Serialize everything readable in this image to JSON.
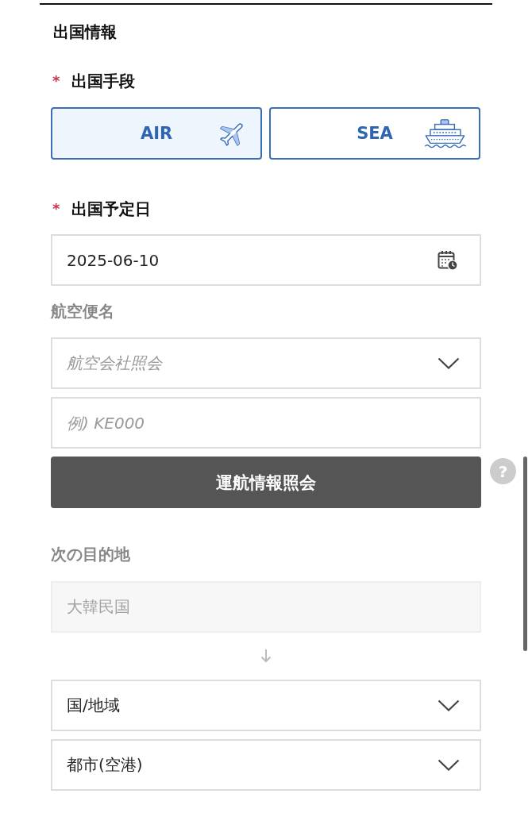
{
  "section_title": "出国情報",
  "departure_mode": {
    "label": "出国手段",
    "required_mark": "*",
    "options": [
      {
        "label": "AIR",
        "kind": "air",
        "selected": true
      },
      {
        "label": "SEA",
        "kind": "ship",
        "selected": false
      }
    ]
  },
  "departure_date": {
    "label": "出国予定日",
    "required_mark": "*",
    "value": "2025-06-10"
  },
  "flight": {
    "label": "航空便名",
    "airline_select": {
      "placeholder": "航空会社照会"
    },
    "flight_number": {
      "placeholder": "例) KE000"
    },
    "lookup_button": "運航情報照会",
    "help": "?"
  },
  "next_destination": {
    "label": "次の目的地",
    "origin": {
      "value": "大韓民国",
      "disabled": true
    },
    "country_select": {
      "value": "国/地域"
    },
    "city_select": {
      "value": "都市(空港)"
    }
  }
}
